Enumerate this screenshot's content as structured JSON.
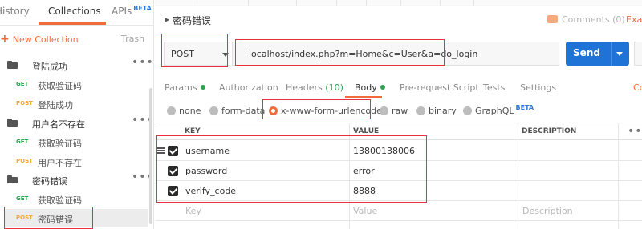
{
  "sidebar": {
    "tabs": [
      {
        "label": "History"
      },
      {
        "label": "Collections"
      },
      {
        "label": "APIs",
        "badge": "BETA"
      }
    ],
    "new_collection": "New Collection",
    "trash": "Trash",
    "folders": [
      {
        "name": "登陆成功",
        "requests": [
          {
            "method": "GET",
            "name": "获取验证码"
          },
          {
            "method": "POST",
            "name": "登陆成功"
          }
        ]
      },
      {
        "name": "用户名不存在",
        "requests": [
          {
            "method": "GET",
            "name": "获取验证码"
          },
          {
            "method": "POST",
            "name": "用户不存在"
          }
        ]
      },
      {
        "name": "密码错误",
        "requests": [
          {
            "method": "GET",
            "name": "获取验证码"
          },
          {
            "method": "POST",
            "name": "密码错误"
          }
        ]
      }
    ]
  },
  "request": {
    "title": "密码错误",
    "comments": "Comments (0)",
    "examples": "Exa",
    "method": "POST",
    "url": "localhost/index.php?m=Home&c=User&a=do_login",
    "send": "Send"
  },
  "req_tabs": [
    {
      "label": "Params",
      "dot": true
    },
    {
      "label": "Authorization"
    },
    {
      "label": "Headers",
      "count": "(10)"
    },
    {
      "label": "Body",
      "dot": true
    },
    {
      "label": "Pre-request Script"
    },
    {
      "label": "Tests"
    },
    {
      "label": "Settings"
    }
  ],
  "cookies": "Co",
  "body_types": [
    {
      "label": "none",
      "selected": false
    },
    {
      "label": "form-data",
      "selected": false
    },
    {
      "label": "x-www-form-urlencoded",
      "selected": true
    },
    {
      "label": "raw",
      "selected": false
    },
    {
      "label": "binary",
      "selected": false
    },
    {
      "label": "GraphQL",
      "badge": "BETA",
      "selected": false
    }
  ],
  "table": {
    "headers": {
      "key": "KEY",
      "value": "VALUE",
      "description": "DESCRIPTION"
    },
    "rows": [
      {
        "key": "username",
        "value": "13800138006",
        "checked": true
      },
      {
        "key": "password",
        "value": "error",
        "checked": true
      },
      {
        "key": "verify_code",
        "value": "8888",
        "checked": true
      }
    ],
    "placeholder": {
      "key": "Key",
      "value": "Value",
      "description": "Description"
    }
  },
  "colors": {
    "accent": "#f26b3a",
    "send": "#1f72d6",
    "get": "#2da44e",
    "post": "#f2a83a",
    "highlight": "#e8303c"
  }
}
